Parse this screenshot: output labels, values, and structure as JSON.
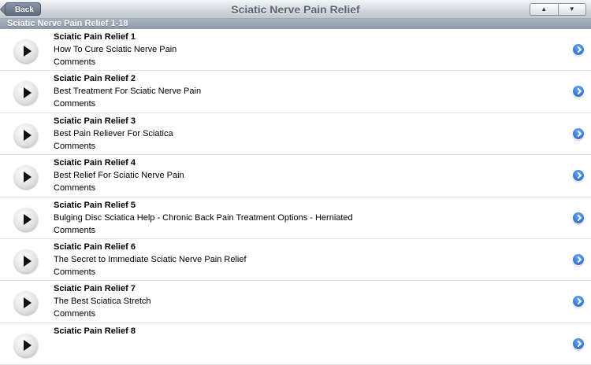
{
  "navbar": {
    "back_label": "Back",
    "title": "Sciatic Nerve Pain Relief",
    "up_arrow": "▲",
    "down_arrow": "▼"
  },
  "section": {
    "header": "Sciatic Nerve Pain Relief 1-18"
  },
  "items": [
    {
      "title": "Sciatic Pain Relief 1",
      "subtitle": "How To Cure Sciatic Nerve Pain",
      "comments": "Comments"
    },
    {
      "title": "Sciatic Pain Relief 2",
      "subtitle": "Best Treatment For Sciatic Nerve Pain",
      "comments": "Comments"
    },
    {
      "title": "Sciatic Pain Relief 3",
      "subtitle": "Best Pain Reliever For Sciatica",
      "comments": "Comments"
    },
    {
      "title": "Sciatic Pain Relief 4",
      "subtitle": "Best Relief For Sciatic Nerve Pain",
      "comments": "Comments"
    },
    {
      "title": "Sciatic Pain Relief 5",
      "subtitle": "Bulging Disc  Sciatica Help - Chronic Back Pain Treatment Options - Herniated",
      "comments": "Comments"
    },
    {
      "title": "Sciatic Pain Relief 6",
      "subtitle": "The Secret to Immediate Sciatic Nerve Pain Relief",
      "comments": "Comments"
    },
    {
      "title": "Sciatic Pain Relief 7",
      "subtitle": "The Best Sciatica Stretch",
      "comments": "Comments"
    },
    {
      "title": "Sciatic Pain Relief 8",
      "subtitle": "",
      "comments": ""
    }
  ]
}
